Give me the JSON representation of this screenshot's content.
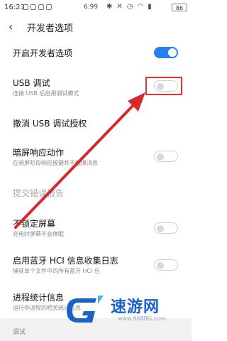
{
  "status_bar": {
    "time": "16:23",
    "speed": "6.99",
    "battery": "86"
  },
  "header": {
    "title": "开发者选项",
    "back_icon": "chevron-left-icon"
  },
  "rows": [
    {
      "title": "开启开发者选项",
      "subtitle": "",
      "toggle": "on"
    },
    {
      "title": "USB 调试",
      "subtitle": "连接 USB 后启用调试模式",
      "toggle": "off"
    },
    {
      "title": "撤消 USB 调试授权",
      "subtitle": "",
      "toggle": ""
    },
    {
      "title": "暗屏响应动作",
      "subtitle": "在暗屏阶段响应按键并不触摸消息",
      "toggle": "off"
    },
    {
      "title": "提交错误报告",
      "subtitle": "",
      "toggle": ""
    },
    {
      "title": "不锁定屏幕",
      "subtitle": "充电时屏幕不会休眠",
      "toggle": "off"
    },
    {
      "title": "启用蓝牙 HCI 信息收集日志",
      "subtitle": "捕获单个文件中的所有蓝牙 HCI 包",
      "toggle": "off"
    },
    {
      "title": "进程统计信息",
      "subtitle": "运行中进程的相关统计信息",
      "toggle": ""
    }
  ],
  "section_footer": "调试",
  "watermark": {
    "brand": "速游网",
    "url": "www.968BG.com"
  },
  "colors": {
    "toggle_on": "#2a7ff0",
    "highlight": "#e53030",
    "arrow": "#d42a2a",
    "brand": "#1a61c8"
  }
}
